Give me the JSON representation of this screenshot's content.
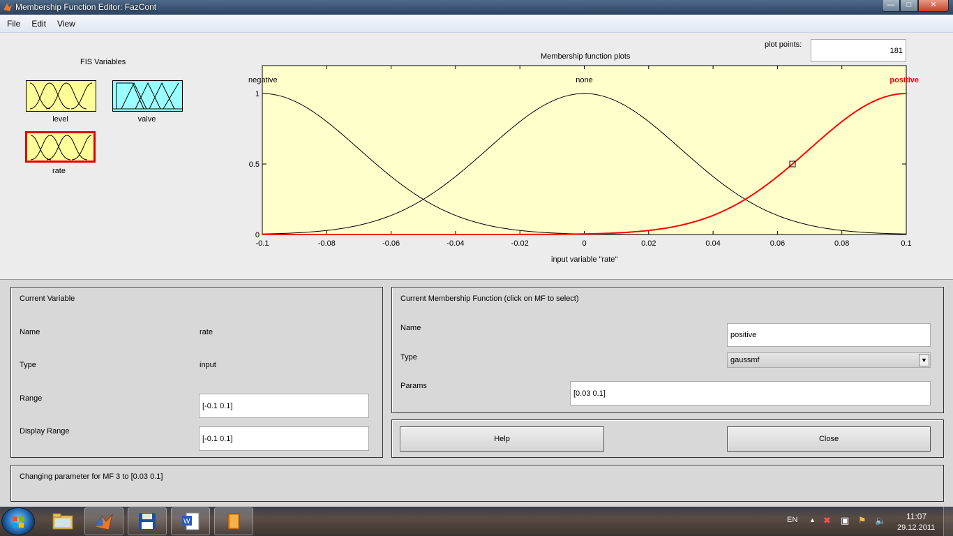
{
  "window": {
    "title": "Membership Function Editor: FazCont"
  },
  "menu": [
    "File",
    "Edit",
    "View"
  ],
  "fis": {
    "heading": "FIS Variables",
    "variables": [
      {
        "label": "level",
        "color": "#ffff99",
        "selected": false
      },
      {
        "label": "valve",
        "color": "#99ffff",
        "selected": false
      },
      {
        "label": "rate",
        "color": "#ffff99",
        "selected": true
      }
    ]
  },
  "plot": {
    "title": "Membership function plots",
    "plot_points_label": "plot points:",
    "plot_points_value": "181",
    "xlabel": "input variable \"rate\"",
    "mf_labels": [
      "negative",
      "none",
      "positive"
    ],
    "selected_color": "#ff0000",
    "y_ticks": [
      "0",
      "0.5",
      "1"
    ],
    "x_ticks": [
      "-0.1",
      "-0.08",
      "-0.06",
      "-0.04",
      "-0.02",
      "0",
      "0.02",
      "0.04",
      "0.06",
      "0.08",
      "0.1"
    ]
  },
  "chart_data": {
    "type": "line",
    "xlabel": "input variable \"rate\"",
    "xlim": [
      -0.1,
      0.1
    ],
    "ylim": [
      0,
      1
    ],
    "series": [
      {
        "name": "negative",
        "mf": "gaussmf",
        "sigma": 0.03,
        "center": -0.1
      },
      {
        "name": "none",
        "mf": "gaussmf",
        "sigma": 0.03,
        "center": 0
      },
      {
        "name": "positive",
        "mf": "gaussmf",
        "sigma": 0.03,
        "center": 0.1
      }
    ],
    "selected_series": "positive",
    "grid": true
  },
  "current_variable": {
    "heading": "Current Variable",
    "name_label": "Name",
    "name_value": "rate",
    "type_label": "Type",
    "type_value": "input",
    "range_label": "Range",
    "range_value": "[-0.1 0.1]",
    "display_range_label": "Display Range",
    "display_range_value": "[-0.1 0.1]"
  },
  "current_mf": {
    "heading": "Current Membership Function (click on MF to select)",
    "name_label": "Name",
    "name_value": "positive",
    "type_label": "Type",
    "type_value": "gaussmf",
    "params_label": "Params",
    "params_value": "[0.03 0.1]"
  },
  "buttons": {
    "help": "Help",
    "close": "Close"
  },
  "status": "Changing parameter for MF 3 to  [0.03 0.1]",
  "taskbar": {
    "lang": "EN",
    "time": "11:07",
    "date": "29.12.2011"
  }
}
